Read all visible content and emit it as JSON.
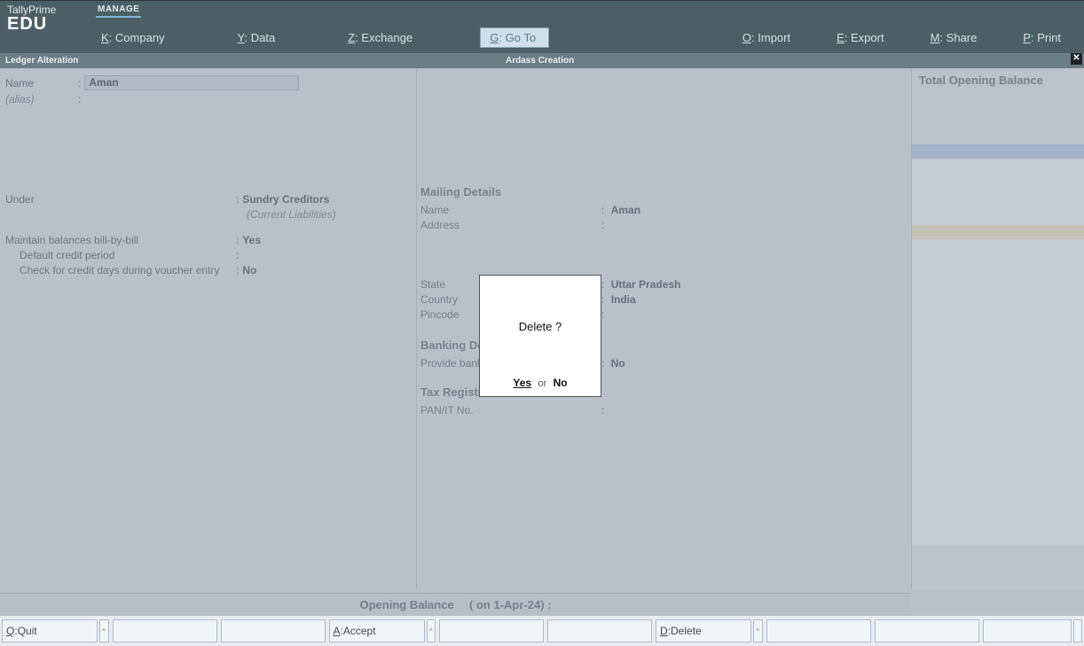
{
  "brand": {
    "line1": "TallyPrime",
    "line2": "EDU"
  },
  "manage_tab": "MANAGE",
  "menu": {
    "company": {
      "key": "K",
      "label": "Company"
    },
    "data": {
      "key": "Y",
      "label": "Data"
    },
    "exchange": {
      "key": "Z",
      "label": "Exchange"
    },
    "goto": {
      "key": "G",
      "label": "Go To"
    },
    "import": {
      "key": "O",
      "label": "Import"
    },
    "export": {
      "key": "E",
      "label": "Export"
    },
    "share": {
      "key": "M",
      "label": "Share"
    },
    "print": {
      "key": "P",
      "label": "Print"
    }
  },
  "title": {
    "left": "Ledger Alteration",
    "center": "Ardass Creation"
  },
  "ledger": {
    "name_label": "Name",
    "name_value": "Aman",
    "alias_label": "(alias)",
    "under_label": "Under",
    "under_value": "Sundry Creditors",
    "under_sub": "(Current Liabilities)",
    "billbybill_label": "Maintain balances bill-by-bill",
    "billbybill_value": "Yes",
    "creditperiod_label": "Default credit period",
    "checkcredit_label": "Check for credit days during voucher entry",
    "checkcredit_value": "No"
  },
  "mailing": {
    "heading": "Mailing Details",
    "name_label": "Name",
    "name_value": "Aman",
    "address_label": "Address",
    "state_label": "State",
    "state_value": "Uttar Pradesh",
    "country_label": "Country",
    "country_value": "India",
    "pincode_label": "Pincode"
  },
  "banking": {
    "heading": "Banking Details",
    "provide_label": "Provide bank details",
    "provide_value": "No"
  },
  "tax": {
    "heading": "Tax Registration Details",
    "pan_label": "PAN/IT No."
  },
  "right": {
    "total_opening": "Total Opening Balance"
  },
  "opening": {
    "label": "Opening Balance",
    "date": "( on 1-Apr-24)  :"
  },
  "bottombar": {
    "quit": {
      "key": "Q",
      "label": "Quit"
    },
    "accept": {
      "key": "A",
      "label": "Accept"
    },
    "delete": {
      "key": "D",
      "label": "Delete"
    }
  },
  "dialog": {
    "question": "Delete ?",
    "yes": "Yes",
    "or": "or",
    "no": "No"
  }
}
